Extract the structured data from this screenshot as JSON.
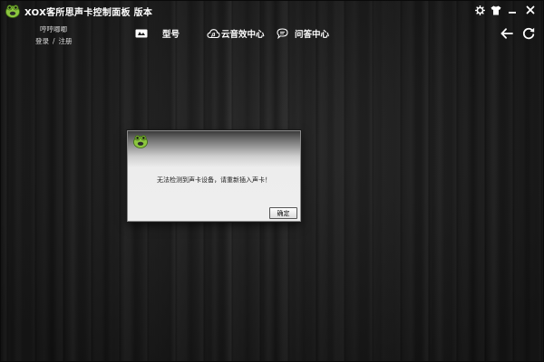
{
  "window": {
    "title": "XOX客所思声卡控制面板  版本",
    "logo_icon": "frog-logo-icon",
    "controls": [
      {
        "name": "settings-icon"
      },
      {
        "name": "skin-icon"
      },
      {
        "name": "minimize-icon"
      },
      {
        "name": "close-icon"
      }
    ]
  },
  "user": {
    "name": "哼哼唧唧",
    "login": "登录",
    "separator": "/",
    "register": "注册"
  },
  "nav": {
    "items": [
      {
        "label": "型号",
        "icon": "model-icon"
      },
      {
        "label": "云音效中心",
        "icon": "cloud-icon"
      },
      {
        "label": "问答中心",
        "icon": "chat-bubble-icon"
      }
    ]
  },
  "toolbar": {
    "back_icon": "arrow-left-icon",
    "refresh_icon": "refresh-icon"
  },
  "dialog": {
    "icon": "frog-logo-icon",
    "message": "无法检测到声卡设备，请重新插入声卡！",
    "ok_label": "确定"
  },
  "colors": {
    "background": "#1d1d1d",
    "text": "#ffffff",
    "logo_green": "#7ab62e"
  }
}
